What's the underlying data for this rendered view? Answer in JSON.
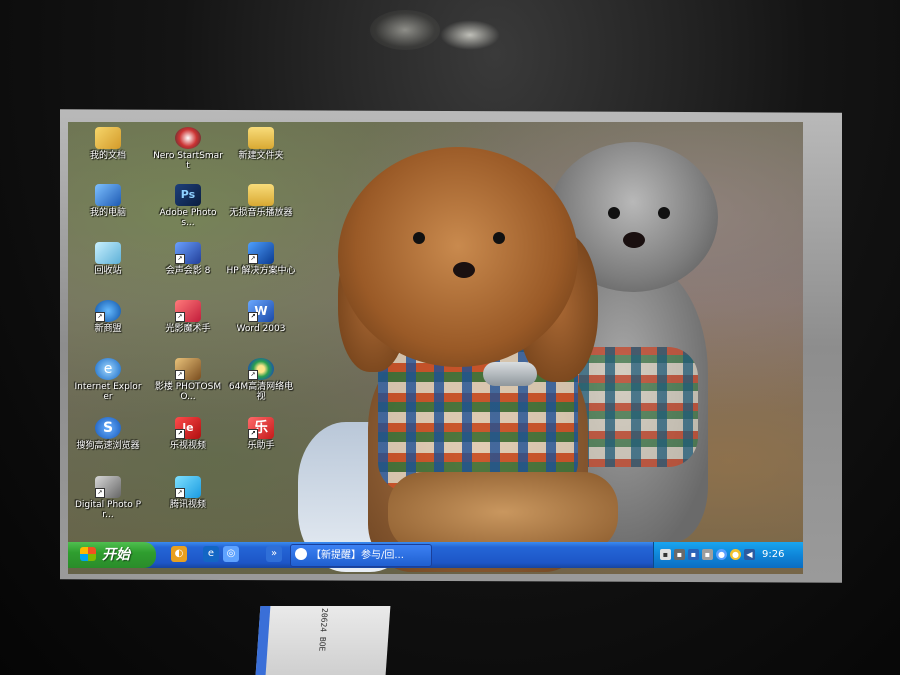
{
  "desktop_icons": [
    {
      "id": "my-documents",
      "label": "我的文档",
      "glyph": "",
      "icon": "document-folder-icon",
      "shortcut": false
    },
    {
      "id": "nero",
      "label": "Nero StartSmart",
      "glyph": "",
      "icon": "nero-icon",
      "shortcut": false
    },
    {
      "id": "new-folder",
      "label": "新建文件夹",
      "glyph": "",
      "icon": "folder-icon",
      "shortcut": false
    },
    {
      "id": "my-computer",
      "label": "我的电脑",
      "glyph": "",
      "icon": "computer-icon",
      "shortcut": false
    },
    {
      "id": "photoshop",
      "label": "Adobe Photos...",
      "glyph": "Ps",
      "icon": "photoshop-icon",
      "shortcut": false
    },
    {
      "id": "music-player",
      "label": "无损音乐播放器",
      "glyph": "",
      "icon": "music-folder-icon",
      "shortcut": false
    },
    {
      "id": "recycle-bin",
      "label": "回收站",
      "glyph": "",
      "icon": "recycle-bin-icon",
      "shortcut": false
    },
    {
      "id": "video-studio",
      "label": "会声会影 8",
      "glyph": "",
      "icon": "video-editor-icon",
      "shortcut": true
    },
    {
      "id": "hp-center",
      "label": "HP 解决方案中心",
      "glyph": "",
      "icon": "hp-solution-center-icon",
      "shortcut": true
    },
    {
      "id": "xinliangmeng",
      "label": "新商盟",
      "glyph": "",
      "icon": "web-icon",
      "shortcut": true
    },
    {
      "id": "light-magic",
      "label": "光影魔术手",
      "glyph": "",
      "icon": "photo-magic-icon",
      "shortcut": true
    },
    {
      "id": "word",
      "label": "Word 2003",
      "glyph": "W",
      "icon": "word-icon",
      "shortcut": true
    },
    {
      "id": "ie",
      "label": "Internet Explorer",
      "glyph": "e",
      "icon": "internet-explorer-icon",
      "shortcut": false
    },
    {
      "id": "photosmart",
      "label": "影楼 PHOTOSMO...",
      "glyph": "",
      "icon": "photo-studio-icon",
      "shortcut": true
    },
    {
      "id": "tv64",
      "label": "64M高清网络电视",
      "glyph": "",
      "icon": "network-tv-icon",
      "shortcut": true
    },
    {
      "id": "sogou",
      "label": "搜狗高速浏览器",
      "glyph": "S",
      "icon": "sogou-browser-icon",
      "shortcut": false
    },
    {
      "id": "letv",
      "label": "乐视视频",
      "glyph": "le",
      "icon": "letv-icon",
      "shortcut": true
    },
    {
      "id": "le-helper",
      "label": "乐助手",
      "glyph": "乐",
      "icon": "le-helper-icon",
      "shortcut": true
    },
    {
      "id": "digital-photo",
      "label": "Digital Photo Pr...",
      "glyph": "",
      "icon": "digital-photo-icon",
      "shortcut": true
    },
    {
      "id": "tencent-video",
      "label": "腾讯视频",
      "glyph": "",
      "icon": "tencent-video-icon",
      "shortcut": true
    }
  ],
  "taskbar": {
    "start_label": "开始",
    "quick_launch": [
      {
        "icon": "media-icon",
        "glyph": "◐",
        "color": "#e8a020"
      },
      {
        "icon": "ie-quicklaunch-icon",
        "glyph": "e",
        "color": "#1366c4"
      },
      {
        "icon": "browser-quicklaunch-icon",
        "glyph": "◎",
        "color": "#5fa3ff"
      },
      {
        "icon": "show-more-icon",
        "glyph": "»",
        "color": "#2f6fd8"
      }
    ],
    "task_item_label": "【新提醒】参与/回...",
    "tray_icons": [
      {
        "icon": "tray-app-icon-1",
        "glyph": "▪",
        "color": "#e0e0e0"
      },
      {
        "icon": "tray-app-icon-2",
        "glyph": "▪",
        "color": "#6a6a6a"
      },
      {
        "icon": "network-icon",
        "glyph": "▪",
        "color": "#2b63b8"
      },
      {
        "icon": "tray-app-icon-3",
        "glyph": "▪",
        "color": "#9e9e9e"
      },
      {
        "icon": "tray-app-icon-4",
        "glyph": "●",
        "color": "#5aa0ff"
      },
      {
        "icon": "tray-app-icon-5",
        "glyph": "●",
        "color": "#f2c230"
      },
      {
        "icon": "volume-icon",
        "glyph": "◀",
        "color": "#2c5aa0"
      }
    ],
    "clock": "9:26"
  },
  "cable_text": "20624 BOE"
}
